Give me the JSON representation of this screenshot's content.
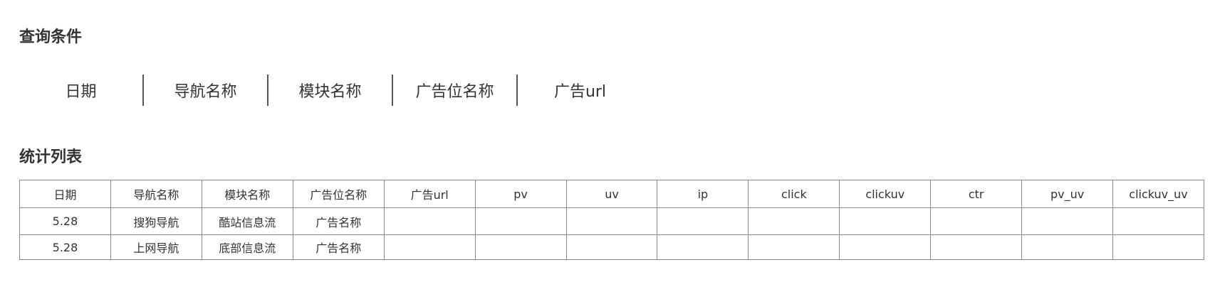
{
  "query_section": {
    "title": "查询条件",
    "filters": [
      "日期",
      "导航名称",
      "模块名称",
      "广告位名称",
      "广告url"
    ]
  },
  "stats_section": {
    "title": "统计列表",
    "columns": [
      "日期",
      "导航名称",
      "模块名称",
      "广告位名称",
      "广告url",
      "pv",
      "uv",
      "ip",
      "click",
      "clickuv",
      "ctr",
      "pv_uv",
      "clickuv_uv"
    ],
    "rows": [
      [
        "5.28",
        "搜狗导航",
        "酷站信息流",
        "广告名称",
        "",
        "",
        "",
        "",
        "",
        "",
        "",
        "",
        ""
      ],
      [
        "5.28",
        "上网导航",
        "底部信息流",
        "广告名称",
        "",
        "",
        "",
        "",
        "",
        "",
        "",
        "",
        ""
      ]
    ]
  }
}
